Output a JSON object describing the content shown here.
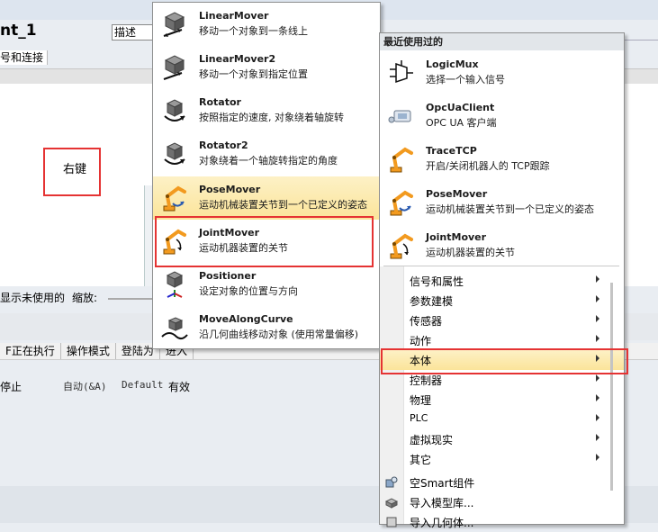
{
  "background": {
    "title": "nt_1",
    "description_label": "描述",
    "tab_label": "号和连接",
    "right_click_note": "右键",
    "show_unused": "显示未使用的",
    "zoom_label": "缩放:",
    "table_headers": [
      "F正在执行",
      "操作模式",
      "登陆为",
      "进入"
    ],
    "row": {
      "status": "停止",
      "mode": "自动(&A)",
      "login": "Default",
      "validity": "有效"
    }
  },
  "menu_main": {
    "items": [
      {
        "title": "LinearMover",
        "desc": "移动一个对象到一条线上",
        "icon": "linear-mover-icon"
      },
      {
        "title": "LinearMover2",
        "desc": "移动一个对象到指定位置",
        "icon": "linear-mover2-icon"
      },
      {
        "title": "Rotator",
        "desc": "按照指定的速度, 对象绕着轴旋转",
        "icon": "rotator-icon"
      },
      {
        "title": "Rotator2",
        "desc": "对象绕着一个轴旋转指定的角度",
        "icon": "rotator2-icon"
      },
      {
        "title": "PoseMover",
        "desc": "运动机械装置关节到一个已定义的姿态",
        "icon": "pose-mover-icon"
      },
      {
        "title": "JointMover",
        "desc": "运动机器装置的关节",
        "icon": "joint-mover-icon"
      },
      {
        "title": "Positioner",
        "desc": "设定对象的位置与方向",
        "icon": "positioner-icon"
      },
      {
        "title": "MoveAlongCurve",
        "desc": "沿几何曲线移动对象 (使用常量偏移)",
        "icon": "move-along-curve-icon"
      }
    ]
  },
  "menu_recent": {
    "header": "最近使用过的",
    "recent": [
      {
        "title": "LogicMux",
        "desc": "选择一个输入信号",
        "icon": "logic-mux-icon"
      },
      {
        "title": "OpcUaClient",
        "desc": "OPC UA 客户端",
        "icon": "opc-ua-client-icon"
      },
      {
        "title": "TraceTCP",
        "desc": "开启/关闭机器人的 TCP跟踪",
        "icon": "trace-tcp-icon"
      },
      {
        "title": "PoseMover",
        "desc": "运动机械装置关节到一个已定义的姿态",
        "icon": "pose-mover-icon"
      },
      {
        "title": "JointMover",
        "desc": "运动机器装置的关节",
        "icon": "joint-mover-icon"
      }
    ],
    "submenus": [
      "信号和属性",
      "参数建模",
      "传感器",
      "动作",
      "本体",
      "控制器",
      "物理",
      "PLC",
      "虚拟现实",
      "其它"
    ],
    "active_submenu": "本体",
    "actions": [
      "空Smart组件",
      "导入模型库...",
      "导入几何体..."
    ]
  },
  "colors": {
    "highlight_border": "#e53333",
    "hover_fill": "#fbe49a",
    "robot_orange": "#f29a1f"
  }
}
